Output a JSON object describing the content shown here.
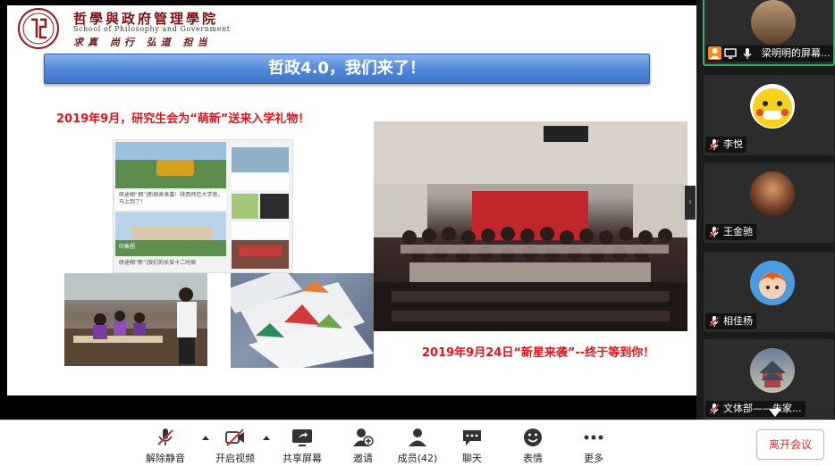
{
  "slide": {
    "school_name": "哲學與政府管理學院",
    "school_name_en": "School of Philosophy and Government",
    "motto": "求真 尚行 弘道 担当",
    "title": "哲政4.0，我们来了！",
    "caption_top": "2019年9月，研究生会为“萌新”送来入学礼物！",
    "caption_bottom": "2019年9月24日“新星来袭”--终于等到你！",
    "collage": {
      "text_1": "研途相“拥”|新宿舍来袭！陕西师范大学南，马上到了！",
      "text_2": "研途相“新”|我们的长安十二时辰",
      "badge": "印象圈"
    }
  },
  "participants": [
    {
      "name": "梁明明的屏幕...",
      "active": true,
      "muted": false
    },
    {
      "name": "李悦",
      "active": false,
      "muted": true
    },
    {
      "name": "王金驰",
      "active": false,
      "muted": true
    },
    {
      "name": "相佳杨",
      "active": false,
      "muted": true
    },
    {
      "name": "文体部——朱家...",
      "active": false,
      "muted": true
    }
  ],
  "toolbar": {
    "unmute": "解除静音",
    "start_video": "开启视频",
    "share_screen": "共享屏幕",
    "invite": "邀请",
    "members": "成员(42)",
    "chat": "聊天",
    "reactions": "表情",
    "more": "更多",
    "leave": "离开会议"
  },
  "colors": {
    "slide_title_bar": "#4f86d8",
    "caption_red": "#e0131d",
    "active_speaker": "#2fb36b",
    "muted_red": "#e02b2b",
    "leave_red": "#e02b2b"
  }
}
